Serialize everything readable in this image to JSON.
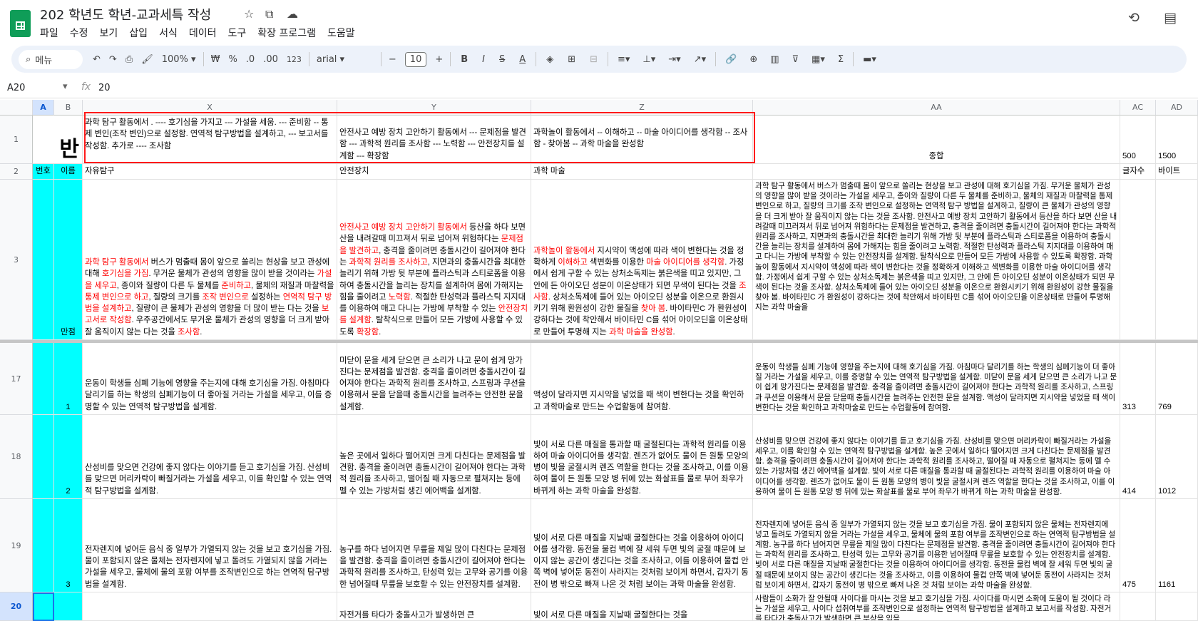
{
  "title": "202 학년도 학년-교과세특 작성",
  "menu": [
    "파일",
    "수정",
    "보기",
    "삽입",
    "서식",
    "데이터",
    "도구",
    "확장 프로그램",
    "도움말"
  ],
  "toolbar": {
    "search": "메뉴",
    "zoom": "100%",
    "currency": "₩",
    "percent": "%",
    "dec_less": ".0",
    "dec_more": ".00",
    "format_123": "123",
    "font": "arial",
    "font_size": "10",
    "bold": "B",
    "italic": "I",
    "strike": "S",
    "text_color": "A"
  },
  "formula": {
    "namebox": "A20",
    "fx": "fx",
    "value": "20"
  },
  "columns": {
    "A": "A",
    "B": "B",
    "X": "X",
    "Y": "Y",
    "Z": "Z",
    "AA": "AA",
    "AC": "AC",
    "AD": "AD"
  },
  "rows": {
    "r1": "1",
    "r2": "2",
    "r3": "3",
    "r17": "17",
    "r18": "18",
    "r19": "19"
  },
  "row1": {
    "ban": "반",
    "x": "과학 탐구 활동에서 . ---- 호기심을 가지고 --- 가설을 세움. --- 준비함 -- 통제 변인(조작 변인)으로 설정함. 연역적 탐구방법을 설계하고, --- 보고서를 작성함. 추가로 ---- 조사함",
    "y": "안전사고 예방 장치 고안하기 활동에서 --- 문제점을 발견함 --- 과학적 원리를 조사함 --- 노력함 --- 안전장치를 설계함 --- 확장함",
    "z": "과학놀이 활동에서 -- 이해하고 -- 마술 아이디어를 생각함 -- 조사함 - 찾아봄 -- 과학 마술을 완성함",
    "aa": "종합",
    "ac": "500",
    "ad": "1500"
  },
  "row2": {
    "a": "번호",
    "b": "이름",
    "x": "자유탐구",
    "y": "안전장치",
    "z": "과학 마술",
    "ac": "글자수",
    "ad": "바이트"
  },
  "row3": {
    "b": "만점",
    "x": [
      [
        "과학 탐구 활동에서",
        1
      ],
      [
        " 버스가 멈출때 몸이 앞으로 쏠리는 현상을 보고 관성에 대해 ",
        0
      ],
      [
        "호기심을 가짐",
        1
      ],
      [
        ". 무거운 물체가 관성의 영향을 많이 받을 것이라는 ",
        0
      ],
      [
        "가설을 세우고",
        1
      ],
      [
        ", 종이와 질량이 다른 두 물체를 ",
        0
      ],
      [
        "준비하고",
        1
      ],
      [
        ", 물체의 재질과 마찰력을 ",
        0
      ],
      [
        "통제 변인으로 하고",
        1
      ],
      [
        ", 질량의 크기를 ",
        0
      ],
      [
        "조작 변인으로",
        1
      ],
      [
        " 설정하는 ",
        0
      ],
      [
        "연역적 탐구 방법을 설계하고",
        1
      ],
      [
        ", 질량이 큰 물체가 관성의 영향을 더 많이 받는 다는 것을 ",
        0
      ],
      [
        "보고서로 작성함",
        1
      ],
      [
        ". 우주공간에서도 무거운 물체가 관성의 영향을 더 크게 받아 잘 움직이지 않는 다는 것을 ",
        0
      ],
      [
        "조사함",
        1
      ],
      [
        ".",
        0
      ]
    ],
    "y": [
      [
        "안전사고 예방 장치 고안하기 활동에서",
        1
      ],
      [
        " 등산을 하다 보면 산을 내려갈때 미끄져서 뒤로 넘어져 위험하다는 ",
        0
      ],
      [
        "문제점을 발견하고",
        1
      ],
      [
        ", 충격을 줄이려면 충돌시간이 길어져야 한다는 ",
        0
      ],
      [
        "과학적 원리를 조사하고",
        1
      ],
      [
        ", 지면과의 충돌시간을 최대한 늘리기 위해 가방 뒷 부분에 플라스틱과 스티로폼을 이용하여 충돌시간을 늘리는 장치를 설계하여 몸에 가해지는 힘을 줄이려고 ",
        0
      ],
      [
        "노력함",
        1
      ],
      [
        ". 적절한 탄성력과 플라스틱 지지대를 이용하여 매고 다니는 가방에 부착할 수 있는 ",
        0
      ],
      [
        "안전장치를 설계함",
        1
      ],
      [
        ". 탈착식으로 만들어 모든 가방에 사용할 수 있도록 ",
        0
      ],
      [
        "확장함",
        1
      ],
      [
        ".",
        0
      ]
    ],
    "z": [
      [
        "과학놀이 활동에서",
        1
      ],
      [
        " 지시약이 액성에 따라 색이 변한다는 것을 정확하게 ",
        0
      ],
      [
        "이해하고",
        1
      ],
      [
        " 색변화를 이용한 ",
        0
      ],
      [
        "마술 아이디어를 생각함",
        1
      ],
      [
        ". 가정에서 쉽게 구할 수 있는 상처소독제는 붉은색을 띠고 있지만, 그 안에 든 아이오딘 성분이 이온상태가 되면 무색이 된다는 것을 ",
        0
      ],
      [
        "조사함",
        1
      ],
      [
        ". 상처소독제에 들어 있는 아이오딘 성분을 이온으로 환원시키기 위해 환원성이 강한 물질을 ",
        0
      ],
      [
        "찾아 봄",
        1
      ],
      [
        ". 바이타민C 가 환원성이 강하다는 것에 착안해서 바이타민 C를 섞어 아이오딘을 이온상태로 만들어 투명해 지는 ",
        0
      ],
      [
        "과학 마술을 완성함",
        1
      ],
      [
        ".",
        0
      ]
    ],
    "aa": "과학 탐구 활동에서 버스가 멈출때 몸이 앞으로 쏠리는 현상을 보고 관성에 대해 호기심을 가짐. 무거운 물체가 관성의 영향을 많이 받을 것이라는 가설을 세우고, 종이와 질량이 다른 두 물체를 준비하고, 물체의 재질과 마찰력을 통제 변인으로 하고, 질량의 크기를 조작 변인으로 설정하는 연역적 탐구 방법을 설계하고, 질량이 큰 물체가 관성의 영향을 더 크게 받아 잘 움직이지 않는 다는 것을 조사함. 안전사고 예방 장치 고안하기 활동에서 등산을 하다 보면 산을 내려갈때 미끄러져서 뒤로 넘어져 위험하다는 문제점을 발견하고, 충격을 줄이려면 충돌시간이 길어져야 한다는 과학적 원리를 조사하고, 지면과의 충돌시간을 최대한 늘리기 위해 가방 뒷 부분에 플라스틱과 스티로폼을 이용하여 충돌시간을 늘리는 장치를 설계하여 몸에 가해지는 힘을 줄이려고 노력함. 적절한 탄성력과 플라스틱 지지대를 이용하여 매고 다니는 가방에 부착할 수 있는 안전장치를 설계함. 탈착식으로 만들어 모든 가방에 사용할 수 있도록 확장함. 과학놀이 활동에서 지시약이 액성에 따라 색이 변한다는 것을 정확하게 이해하고 색변화를 이용한 마술 아이디어를 생각함. 가정에서 쉽게 구할 수 있는 상처소독제는 붉은색을 띠고 있지만, 그 안에 든 아이오딘 성분이 이온상태가 되면 무색이 된다는 것을 조사함. 상처소독제에 들어 있는 아이오딘 성분을 이온으로 환원시키기 위해 환원성이 강한 물질을 찾아 봄. 바이타민C 가 환원성이 강하다는 것에 착안해서 바이타민 C를 섞어 아이오딘을 이온상태로 만들어 투명해 지는 과학 마술을"
  },
  "row17": {
    "b": "1",
    "x": "운동이 학생들 심폐 기능에 영향을 주는지에 대해 호기심을 가짐. 아침마다 달리기를 하는 학생의 심폐기능이 더 좋아질 거라는 가설을 세우고, 이를 증명할 수 있는 연역적 탐구방법을 설계함.",
    "y": "미닫이 문을 세게 닫으면 큰 소리가 나고 문이 쉽게 망가진다는 문제점을 발견함. 충격을 줄이려면 충돌시간이 길어져야 한다는 과학적 원리를 조사하고, 스프링과 쿠션을 이용해서 문을 닫을때 충돌시간을 늘려주는 안전한 문을 설계함.",
    "z": "액성이 달라지면 지시약을 넣었을 때 색이 변한다는 것을 확인하고 과학마술로 만드는 수업활동에 참여함.",
    "aa": "운동이 학생들 심폐 기능에 영향을 주는지에 대해 호기심을 가짐. 아침마다 달리기를 하는 학생의 심폐기능이 더 좋아질 거라는 가설을 세우고, 이를 증명할 수 있는 연역적 탐구방법을 설계함. 미닫이 문을 세게 닫으면 큰 소리가 나고 문이 쉽게 망가진다는 문제점을 발견함. 충격을 줄이려면 충돌시간이 길어져야 한다는 과학적 원리를 조사하고, 스프링과 쿠션을 이용해서 문을 닫을때 충돌시간을 늘려주는 안전한 문을 설계함. 액성이 달라지면 지시약을 넣었을 때 색이 변한다는 것을 확인하고 과학마술로 만드는 수업활동에 참여함.",
    "ac": "313",
    "ad": "769"
  },
  "row18": {
    "b": "2",
    "x": "산성비를 맞으면 건강에 좋지 않다는 이야기를 듣고 호기심을 가짐. 산성비를 맞으면 머리카락이 빠질거라는 가설을 세우고, 이를 확인할 수 있는 연역적 탐구방법을 설계함.",
    "y": "높은 곳에서 일하다 떨어지면 크게 다친다는 문제점을 발견함. 충격을 줄이려면 충돌시간이 길어져야 한다는 과학적 원리를 조사하고, 떨어질 때 자동으로 펼쳐지는 등에 멜 수 있는 가방처럼 생긴 에어백을 설계함.",
    "z": "빛이 서로 다른 매질을 통과할 때 굴절된다는 과학적 원리를 이용하여 마술 아이디어를 생각함. 렌즈가 없어도 물이 든 원통 모양의 병이 빛을 굴절시켜 렌즈 역할을 한다는 것을 조사하고, 이를 이용하여 물이 든 원통 모양 병 뒤에 있는 화살표를 물로 부어 좌우가 바뀌게 하는 과학 마술을 완성함.",
    "aa": "산성비를 맞으면 건강에 좋지 않다는 이야기를 듣고 호기심을 가짐. 산성비를 맞으면 머리카락이 빠질거라는 가설을 세우고, 이를 확인할 수 있는 연역적 탐구방법을 설계함. 높은 곳에서 일하다 떨어지면 크게 다친다는 문제점을 발견함. 충격을 줄이려면 충돌시간이 길어져야 한다는 과학적 원리를 조사하고, 떨어질 때 자동으로 펼쳐지는 등에 멜 수 있는 가방처럼 생긴 에어백을 설계함. 빛이 서로 다른 매질을 통과할 때 굴절된다는 과학적 원리를 이용하여 마술 아이디어를 생각함. 렌즈가 없어도 물이 든 원통 모양의 병이 빛을 굴절시켜 렌즈 역할을 한다는 것을 조사하고, 이를 이용하여 물이 든 원통 모양 병 뒤에 있는 화살표를 물로 부어 좌우가 바뀌게 하는 과학 마술을 완성함.",
    "ac": "414",
    "ad": "1012"
  },
  "row19": {
    "b": "3",
    "x": "전자렌지에 넣어둔 음식 중 일부가 가열되지 않는 것을 보고 호기심을 가짐. 물이 포함되지 않은 물체는 전자렌지에 넣고 돌려도 가열되지 않을 거라는 가설을 세우고, 물체에 물의 포함 여부를 조작변인으로 하는 연역적 탐구방법을 설계함.",
    "y": "농구를 하다 넘어지면 무릎을 제일 많이 다친다는 문제점을 발견함. 충격을 줄이려면 충돌시간이 길어져야 한다는 과학적 원리를 조사하고, 탄성력 있는 고무와 공기를 이용한 넘어질때 무릎을 보호할 수 있는 안전장치를 설계함.",
    "z": "빛이 서로 다른 매질을 지날때 굴절한다는 것을 이용하여 아이디어를 생각함. 동전을 물컵 벽에 잘 세워 두면 빛의 굴절 때문에 보이지 않는 공간이 생긴다는 것을 조사하고, 이를 이용하여 물컵 안쪽 벽에 넣어둔 동전이 사라지는 것처럼 보이게 하면서, 갑자기 동전이 병 밖으로 빠져 나온 것 처럼 보이는 과학 마술을 완성함.",
    "aa": "전자렌지에 넣어둔 음식 중 일부가 가열되지 않는 것을 보고 호기심을 가짐. 물이 포함되지 않은 물체는 전자렌지에 넣고 돌려도 가열되지 않을 거라는 가설을 세우고, 물체에 물의 포함 여부를 조작변인으로 하는 연역적 탐구방법을 설계함. 농구를 하다 넘어지면 무릎을 제일 많이 다친다는 문제점을 발견함. 충격을 줄이려면 충돌시간이 길어져야 한다는 과학적 원리를 조사하고, 탄성력 있는 고무와 공기를 이용한 넘어질때 무릎을 보호할 수 있는 안전장치를 설계함. 빛이 서로 다른 매질을 지날때 굴절한다는 것을 이용하여 아이디어를 생각함. 동전을 물컵 벽에 잘 세워 두면 빛의 굴절 때문에 보이지 않는 공간이 생긴다는 것을 조사하고, 이를 이용하여 물컵 안쪽 벽에 넣어둔 동전이 사라지는 것처럼 보이게 하면서, 갑자기 동전이 병 밖으로 빠져 나온 것 처럼 보이는 과학 마술을 완성함.",
    "ac": "475",
    "ad": "1161"
  },
  "row20": {
    "y": "자전거를 타다가 충돌사고가 발생하면 큰",
    "z": "빛이 서로 다른 매질을 지날때 굴절한다는 것을",
    "aa": "사람들이 소화가 잘 안될때 사이다를 마시는 것을 보고 호기심을 가짐. 사이다를 마시면 소화에 도움이 될 것이다 라는 가설을 세우고, 사이다 섭취여부를 조작변인으로 설정하는 연역적 탐구방법을 설계하고 보고서를 작성함. 자전거를 타다가 충돌사고가 발생하면 큰 부상을 입을"
  }
}
